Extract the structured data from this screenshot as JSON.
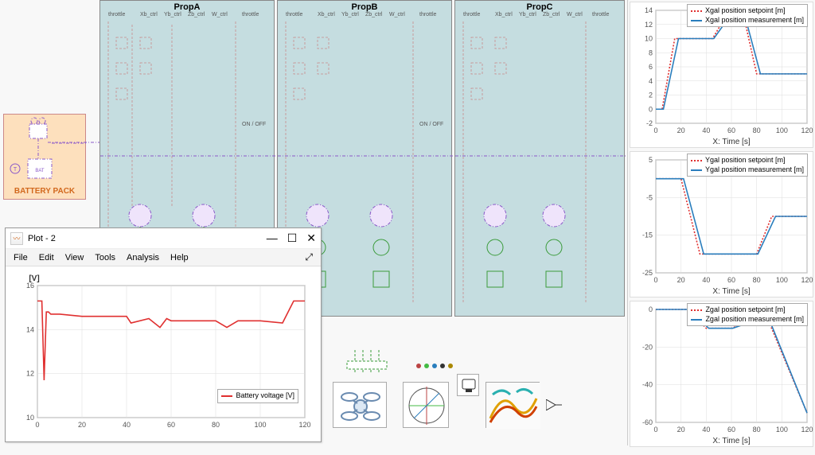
{
  "subsystems": {
    "a": {
      "title": "PropA",
      "on_off": "ON / OFF",
      "ports": [
        "throttle",
        "Xb_ctrl",
        "Yb_ctrl",
        "Zb_ctrl",
        "W_ctrl",
        "throttle"
      ]
    },
    "b": {
      "title": "PropB",
      "on_off": "ON / OFF",
      "ports": [
        "throttle",
        "Xb_ctrl",
        "Yb_ctrl",
        "Zb_ctrl",
        "W_ctrl",
        "throttle"
      ]
    },
    "c": {
      "title": "PropC",
      "ports": [
        "throttle",
        "Xb_ctrl",
        "Yb_ctrl",
        "Zb_ctrl",
        "W_ctrl",
        "throttle"
      ]
    }
  },
  "battery": {
    "label": "BATTERY PACK"
  },
  "plot_window": {
    "title": "Plot - 2",
    "menu": {
      "file": "File",
      "edit": "Edit",
      "view": "View",
      "tools": "Tools",
      "analysis": "Analysis",
      "help": "Help"
    }
  },
  "chart_data": [
    {
      "id": "battery_voltage",
      "type": "line",
      "ylabel_short": "[V]",
      "xlim": [
        0,
        120
      ],
      "ylim": [
        10,
        16
      ],
      "xticks": [
        0,
        20,
        40,
        60,
        80,
        100,
        120
      ],
      "yticks": [
        10,
        12,
        14,
        16
      ],
      "series": [
        {
          "name": "Battery voltage [V]",
          "color": "#e03030",
          "style": "solid",
          "x": [
            0,
            2,
            3,
            4,
            5,
            6,
            8,
            10,
            20,
            30,
            40,
            42,
            50,
            55,
            58,
            60,
            70,
            80,
            85,
            90,
            100,
            110,
            115,
            120
          ],
          "y": [
            15.3,
            15.3,
            11.7,
            14.8,
            14.8,
            14.7,
            14.7,
            14.7,
            14.6,
            14.6,
            14.6,
            14.3,
            14.5,
            14.1,
            14.5,
            14.4,
            14.4,
            14.4,
            14.1,
            14.4,
            14.4,
            14.3,
            15.3,
            15.3
          ]
        }
      ]
    },
    {
      "id": "xgal",
      "type": "line",
      "xlabel": "X: Time [s]",
      "xlim": [
        0,
        120
      ],
      "ylim": [
        -2,
        14
      ],
      "xticks": [
        0,
        20,
        40,
        60,
        80,
        100,
        120
      ],
      "yticks": [
        -2,
        0,
        2,
        4,
        6,
        8,
        10,
        12,
        14
      ],
      "series": [
        {
          "name": "Xgal position setpoint [m]",
          "color": "#e03030",
          "style": "dotted",
          "x": [
            0,
            5,
            15,
            45,
            55,
            70,
            80,
            120
          ],
          "y": [
            0,
            0,
            10,
            10,
            13,
            13,
            5,
            5
          ]
        },
        {
          "name": "Xgal position measurement [m]",
          "color": "#2a7ebd",
          "style": "solid",
          "x": [
            0,
            6,
            18,
            46,
            58,
            71,
            83,
            120
          ],
          "y": [
            0,
            0,
            10,
            10,
            13,
            13,
            5,
            5
          ]
        }
      ]
    },
    {
      "id": "ygal",
      "type": "line",
      "xlabel": "X: Time [s]",
      "xlim": [
        0,
        120
      ],
      "ylim": [
        -25,
        5
      ],
      "xticks": [
        0,
        20,
        40,
        60,
        80,
        100,
        120
      ],
      "yticks": [
        -25,
        -15,
        -5,
        5
      ],
      "series": [
        {
          "name": "Ygal position setpoint [m]",
          "color": "#e03030",
          "style": "dotted",
          "x": [
            0,
            20,
            35,
            80,
            92,
            120
          ],
          "y": [
            0,
            0,
            -20,
            -20,
            -10,
            -10
          ]
        },
        {
          "name": "Ygal position measurement [m]",
          "color": "#2a7ebd",
          "style": "solid",
          "x": [
            0,
            22,
            38,
            81,
            95,
            120
          ],
          "y": [
            0,
            0,
            -20,
            -20,
            -10,
            -10
          ]
        }
      ]
    },
    {
      "id": "zgal",
      "type": "line",
      "xlabel": "X: Time [s]",
      "xlim": [
        0,
        120
      ],
      "ylim": [
        -60,
        0
      ],
      "xticks": [
        0,
        20,
        40,
        60,
        80,
        100,
        120
      ],
      "yticks": [
        -60,
        -40,
        -20,
        0
      ],
      "series": [
        {
          "name": "Zgal position setpoint [m]",
          "color": "#e03030",
          "style": "dotted",
          "x": [
            0,
            25,
            40,
            60,
            72,
            90,
            120
          ],
          "y": [
            0,
            0,
            -10,
            -10,
            -7,
            -7,
            -55
          ]
        },
        {
          "name": "Zgal position measurement [m]",
          "color": "#2a7ebd",
          "style": "solid",
          "x": [
            0,
            26,
            42,
            61,
            74,
            91,
            120
          ],
          "y": [
            0,
            0,
            -10,
            -10,
            -7,
            -7,
            -55
          ]
        }
      ]
    }
  ]
}
